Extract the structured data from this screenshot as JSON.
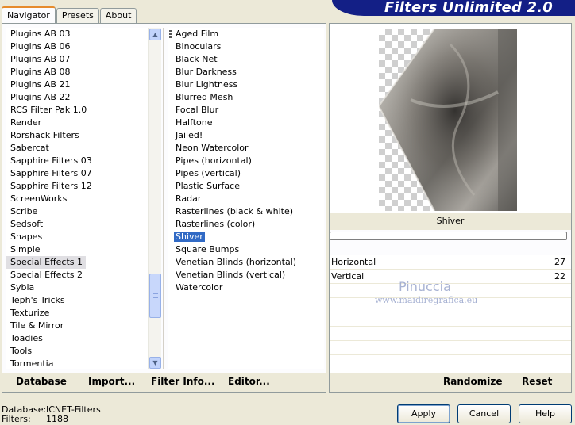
{
  "banner": {
    "title": "Filters Unlimited 2.0"
  },
  "tabs": [
    {
      "label": "Navigator",
      "active": true
    },
    {
      "label": "Presets",
      "active": false
    },
    {
      "label": "About",
      "active": false
    }
  ],
  "categories": [
    "Plugins AB 03",
    "Plugins AB 06",
    "Plugins AB 07",
    "Plugins AB 08",
    "Plugins AB 21",
    "Plugins AB 22",
    "RCS Filter Pak 1.0",
    "Render",
    "Rorshack Filters",
    "Sabercat",
    "Sapphire Filters 03",
    "Sapphire Filters 07",
    "Sapphire Filters 12",
    "ScreenWorks",
    "Scribe",
    "Sedsoft",
    "Shapes",
    "Simple",
    "Special Effects 1",
    "Special Effects 2",
    "Sybia",
    "Teph's Tricks",
    "Texturize",
    "Tile & Mirror",
    "Toadies",
    "Tools",
    "Tormentia"
  ],
  "selected_category": "Special Effects 1",
  "filters": [
    "Aged Film",
    "Binoculars",
    "Black Net",
    "Blur Darkness",
    "Blur Lightness",
    "Blurred Mesh",
    "Focal Blur",
    "Halftone",
    "Jailed!",
    "Neon Watercolor",
    "Pipes (horizontal)",
    "Pipes (vertical)",
    "Plastic Surface",
    "Radar",
    "Rasterlines (black & white)",
    "Rasterlines (color)",
    "Shiver",
    "Square Bumps",
    "Venetian Blinds (horizontal)",
    "Venetian Blinds (vertical)",
    "Watercolor"
  ],
  "selected_filter": "Shiver",
  "nav_buttons": {
    "database": "Database",
    "import": "Import...",
    "filter_info": "Filter Info...",
    "editor": "Editor..."
  },
  "preview": {
    "filter_name": "Shiver"
  },
  "params": [
    {
      "name": "Horizontal",
      "value": "27"
    },
    {
      "name": "Vertical",
      "value": "22"
    }
  ],
  "watermark": {
    "line1": "Pinuccia",
    "line2": "www.maidiregrafica.eu"
  },
  "right_buttons": {
    "randomize": "Randomize",
    "reset": "Reset"
  },
  "status": {
    "database_label": "Database:",
    "database_value": "ICNET-Filters",
    "filters_label": "Filters:",
    "filters_value": "1188"
  },
  "dialog_buttons": {
    "apply": "Apply",
    "cancel": "Cancel",
    "help": "Help"
  },
  "colors": {
    "banner": "#131f86",
    "selection": "#316ac5",
    "tab_accent": "#e68b2c"
  }
}
